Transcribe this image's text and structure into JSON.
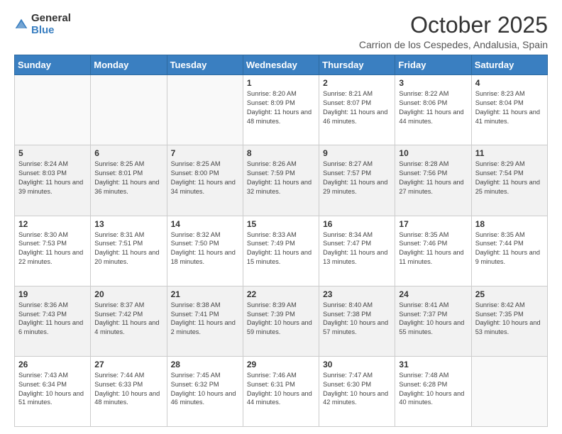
{
  "logo": {
    "general": "General",
    "blue": "Blue"
  },
  "header": {
    "month_year": "October 2025",
    "location": "Carrion de los Cespedes, Andalusia, Spain"
  },
  "days_of_week": [
    "Sunday",
    "Monday",
    "Tuesday",
    "Wednesday",
    "Thursday",
    "Friday",
    "Saturday"
  ],
  "weeks": [
    [
      {
        "day": "",
        "sunrise": "",
        "sunset": "",
        "daylight": ""
      },
      {
        "day": "",
        "sunrise": "",
        "sunset": "",
        "daylight": ""
      },
      {
        "day": "",
        "sunrise": "",
        "sunset": "",
        "daylight": ""
      },
      {
        "day": "1",
        "sunrise": "Sunrise: 8:20 AM",
        "sunset": "Sunset: 8:09 PM",
        "daylight": "Daylight: 11 hours and 48 minutes."
      },
      {
        "day": "2",
        "sunrise": "Sunrise: 8:21 AM",
        "sunset": "Sunset: 8:07 PM",
        "daylight": "Daylight: 11 hours and 46 minutes."
      },
      {
        "day": "3",
        "sunrise": "Sunrise: 8:22 AM",
        "sunset": "Sunset: 8:06 PM",
        "daylight": "Daylight: 11 hours and 44 minutes."
      },
      {
        "day": "4",
        "sunrise": "Sunrise: 8:23 AM",
        "sunset": "Sunset: 8:04 PM",
        "daylight": "Daylight: 11 hours and 41 minutes."
      }
    ],
    [
      {
        "day": "5",
        "sunrise": "Sunrise: 8:24 AM",
        "sunset": "Sunset: 8:03 PM",
        "daylight": "Daylight: 11 hours and 39 minutes."
      },
      {
        "day": "6",
        "sunrise": "Sunrise: 8:25 AM",
        "sunset": "Sunset: 8:01 PM",
        "daylight": "Daylight: 11 hours and 36 minutes."
      },
      {
        "day": "7",
        "sunrise": "Sunrise: 8:25 AM",
        "sunset": "Sunset: 8:00 PM",
        "daylight": "Daylight: 11 hours and 34 minutes."
      },
      {
        "day": "8",
        "sunrise": "Sunrise: 8:26 AM",
        "sunset": "Sunset: 7:59 PM",
        "daylight": "Daylight: 11 hours and 32 minutes."
      },
      {
        "day": "9",
        "sunrise": "Sunrise: 8:27 AM",
        "sunset": "Sunset: 7:57 PM",
        "daylight": "Daylight: 11 hours and 29 minutes."
      },
      {
        "day": "10",
        "sunrise": "Sunrise: 8:28 AM",
        "sunset": "Sunset: 7:56 PM",
        "daylight": "Daylight: 11 hours and 27 minutes."
      },
      {
        "day": "11",
        "sunrise": "Sunrise: 8:29 AM",
        "sunset": "Sunset: 7:54 PM",
        "daylight": "Daylight: 11 hours and 25 minutes."
      }
    ],
    [
      {
        "day": "12",
        "sunrise": "Sunrise: 8:30 AM",
        "sunset": "Sunset: 7:53 PM",
        "daylight": "Daylight: 11 hours and 22 minutes."
      },
      {
        "day": "13",
        "sunrise": "Sunrise: 8:31 AM",
        "sunset": "Sunset: 7:51 PM",
        "daylight": "Daylight: 11 hours and 20 minutes."
      },
      {
        "day": "14",
        "sunrise": "Sunrise: 8:32 AM",
        "sunset": "Sunset: 7:50 PM",
        "daylight": "Daylight: 11 hours and 18 minutes."
      },
      {
        "day": "15",
        "sunrise": "Sunrise: 8:33 AM",
        "sunset": "Sunset: 7:49 PM",
        "daylight": "Daylight: 11 hours and 15 minutes."
      },
      {
        "day": "16",
        "sunrise": "Sunrise: 8:34 AM",
        "sunset": "Sunset: 7:47 PM",
        "daylight": "Daylight: 11 hours and 13 minutes."
      },
      {
        "day": "17",
        "sunrise": "Sunrise: 8:35 AM",
        "sunset": "Sunset: 7:46 PM",
        "daylight": "Daylight: 11 hours and 11 minutes."
      },
      {
        "day": "18",
        "sunrise": "Sunrise: 8:35 AM",
        "sunset": "Sunset: 7:44 PM",
        "daylight": "Daylight: 11 hours and 9 minutes."
      }
    ],
    [
      {
        "day": "19",
        "sunrise": "Sunrise: 8:36 AM",
        "sunset": "Sunset: 7:43 PM",
        "daylight": "Daylight: 11 hours and 6 minutes."
      },
      {
        "day": "20",
        "sunrise": "Sunrise: 8:37 AM",
        "sunset": "Sunset: 7:42 PM",
        "daylight": "Daylight: 11 hours and 4 minutes."
      },
      {
        "day": "21",
        "sunrise": "Sunrise: 8:38 AM",
        "sunset": "Sunset: 7:41 PM",
        "daylight": "Daylight: 11 hours and 2 minutes."
      },
      {
        "day": "22",
        "sunrise": "Sunrise: 8:39 AM",
        "sunset": "Sunset: 7:39 PM",
        "daylight": "Daylight: 10 hours and 59 minutes."
      },
      {
        "day": "23",
        "sunrise": "Sunrise: 8:40 AM",
        "sunset": "Sunset: 7:38 PM",
        "daylight": "Daylight: 10 hours and 57 minutes."
      },
      {
        "day": "24",
        "sunrise": "Sunrise: 8:41 AM",
        "sunset": "Sunset: 7:37 PM",
        "daylight": "Daylight: 10 hours and 55 minutes."
      },
      {
        "day": "25",
        "sunrise": "Sunrise: 8:42 AM",
        "sunset": "Sunset: 7:35 PM",
        "daylight": "Daylight: 10 hours and 53 minutes."
      }
    ],
    [
      {
        "day": "26",
        "sunrise": "Sunrise: 7:43 AM",
        "sunset": "Sunset: 6:34 PM",
        "daylight": "Daylight: 10 hours and 51 minutes."
      },
      {
        "day": "27",
        "sunrise": "Sunrise: 7:44 AM",
        "sunset": "Sunset: 6:33 PM",
        "daylight": "Daylight: 10 hours and 48 minutes."
      },
      {
        "day": "28",
        "sunrise": "Sunrise: 7:45 AM",
        "sunset": "Sunset: 6:32 PM",
        "daylight": "Daylight: 10 hours and 46 minutes."
      },
      {
        "day": "29",
        "sunrise": "Sunrise: 7:46 AM",
        "sunset": "Sunset: 6:31 PM",
        "daylight": "Daylight: 10 hours and 44 minutes."
      },
      {
        "day": "30",
        "sunrise": "Sunrise: 7:47 AM",
        "sunset": "Sunset: 6:30 PM",
        "daylight": "Daylight: 10 hours and 42 minutes."
      },
      {
        "day": "31",
        "sunrise": "Sunrise: 7:48 AM",
        "sunset": "Sunset: 6:28 PM",
        "daylight": "Daylight: 10 hours and 40 minutes."
      },
      {
        "day": "",
        "sunrise": "",
        "sunset": "",
        "daylight": ""
      }
    ]
  ],
  "row_styles": [
    "row-white",
    "row-shaded",
    "row-white",
    "row-shaded",
    "row-white"
  ]
}
